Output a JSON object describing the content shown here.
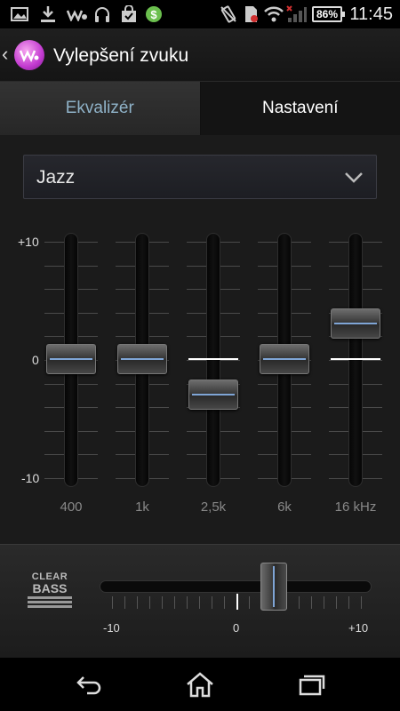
{
  "status_bar": {
    "time": "11:45",
    "battery": "86%",
    "icons": [
      "image-icon",
      "download-icon",
      "walkman-icon",
      "headphones-icon",
      "shopping-bag-icon",
      "money-icon",
      "vibrate-icon",
      "no-sim-icon",
      "wifi-icon",
      "signal-icon"
    ]
  },
  "app_bar": {
    "title": "Vylepšení zvuku"
  },
  "tabs": [
    {
      "label": "Ekvalizér",
      "selected": true
    },
    {
      "label": "Nastavení",
      "selected": false
    }
  ],
  "preset": {
    "value": "Jazz"
  },
  "equalizer": {
    "scale": {
      "max": "+10",
      "zero": "0",
      "min": "-10"
    },
    "bands": [
      {
        "label": "400",
        "value": 0
      },
      {
        "label": "1k",
        "value": 0
      },
      {
        "label": "2,5k",
        "value": -3
      },
      {
        "label": "6k",
        "value": 0
      },
      {
        "label": "16 kHz",
        "value": 3
      }
    ]
  },
  "clear_bass": {
    "logo_top": "CLEAR",
    "logo_bottom": "BASS",
    "value": 3,
    "scale": {
      "min": "-10",
      "zero": "0",
      "max": "+10"
    }
  },
  "colors": {
    "accent": "#7fa5d6",
    "tab_selected_text": "#8fb2c8"
  }
}
